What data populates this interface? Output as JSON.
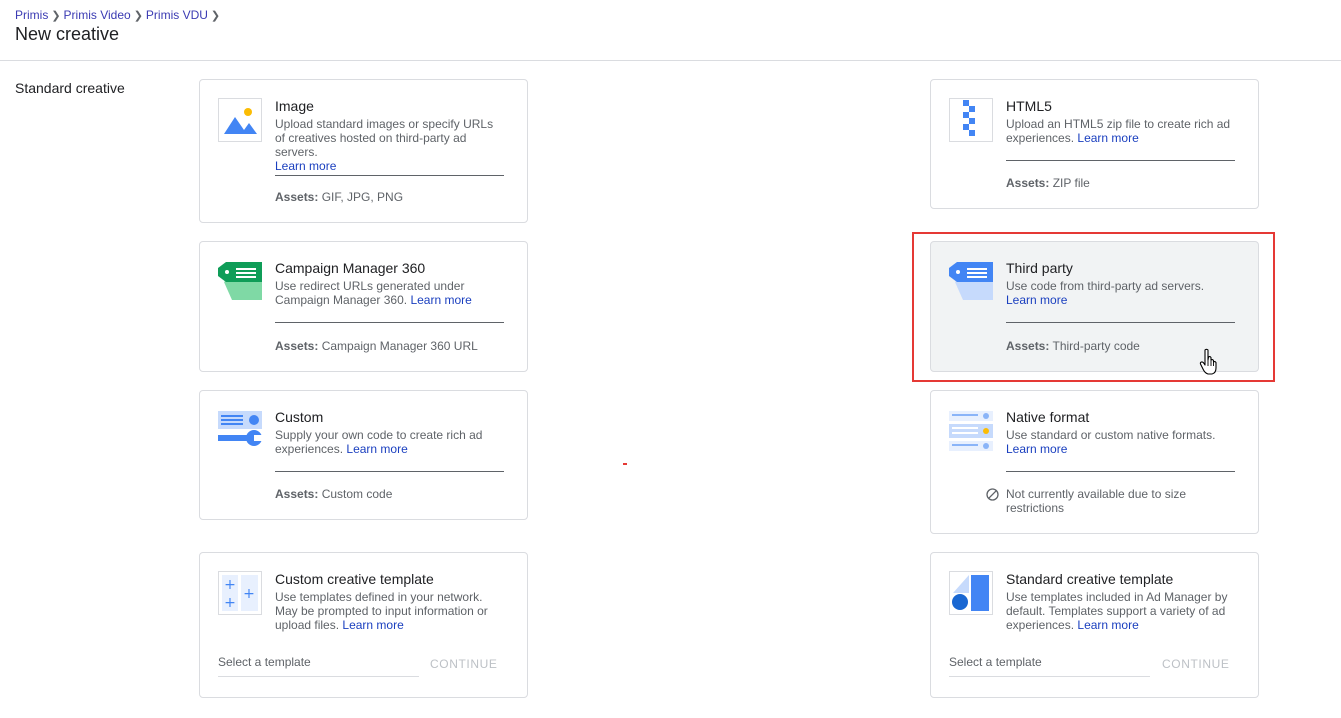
{
  "breadcrumb": {
    "items": [
      "Primis",
      "Primis Video",
      "Primis VDU"
    ],
    "separator": ">"
  },
  "page": {
    "title": "New creative",
    "section_label": "Standard creative"
  },
  "cards": {
    "image": {
      "title": "Image",
      "desc": "Upload standard images or specify URLs of creatives hosted on third-party ad servers.",
      "learn": "Learn more",
      "assets_label": "Assets:",
      "assets_value": "GIF, JPG, PNG"
    },
    "html5": {
      "title": "HTML5",
      "desc": "Upload an HTML5 zip file to create rich ad experiences.",
      "learn": "Learn more",
      "assets_label": "Assets:",
      "assets_value": "ZIP file"
    },
    "cm360": {
      "title": "Campaign Manager 360",
      "desc": "Use redirect URLs generated under Campaign Manager 360.",
      "learn": "Learn more",
      "assets_label": "Assets:",
      "assets_value": "Campaign Manager 360 URL"
    },
    "third_party": {
      "title": "Third party",
      "desc": "Use code from third-party ad servers.",
      "learn": "Learn more",
      "assets_label": "Assets:",
      "assets_value": "Third-party code"
    },
    "custom": {
      "title": "Custom",
      "desc": "Supply your own code to create rich ad experiences.",
      "learn": "Learn more",
      "assets_label": "Assets:",
      "assets_value": "Custom code"
    },
    "native": {
      "title": "Native format",
      "desc": "Use standard or custom native formats.",
      "learn": "Learn more",
      "restriction": "Not currently available due to size restrictions"
    },
    "custom_template": {
      "title": "Custom creative template",
      "desc": "Use templates defined in your network. May be prompted to input information or upload files.",
      "learn": "Learn more",
      "select_placeholder": "Select a template",
      "continue": "CONTINUE"
    },
    "standard_template": {
      "title": "Standard creative template",
      "desc": "Use templates included in Ad Manager by default. Templates support a variety of ad experiences.",
      "learn": "Learn more",
      "select_placeholder": "Select a template",
      "continue": "CONTINUE"
    }
  },
  "colors": {
    "accent_blue": "#4285f4",
    "green": "#0f9d58",
    "yellow": "#fbbc04",
    "highlight": "#e53935"
  }
}
